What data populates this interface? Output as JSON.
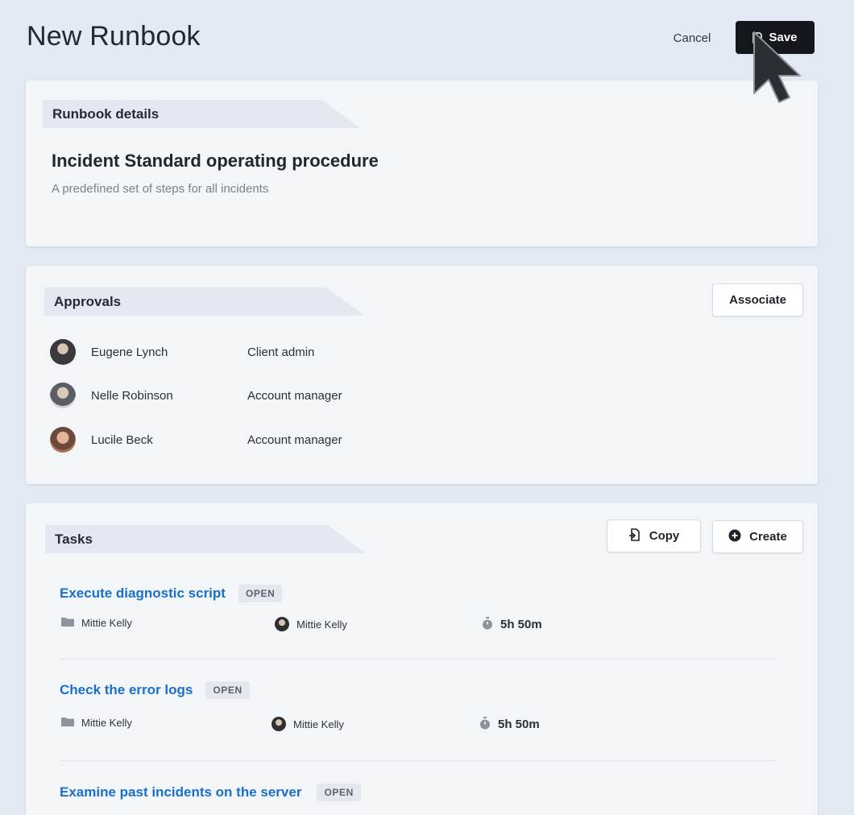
{
  "header": {
    "title": "New Runbook",
    "cancel_label": "Cancel",
    "save_label": "Save"
  },
  "details": {
    "section_label": "Runbook details",
    "name": "Incident Standard operating procedure",
    "description": "A predefined set of steps for all incidents"
  },
  "approvals": {
    "section_label": "Approvals",
    "associate_label": "Associate",
    "approvers": [
      {
        "name": "Eugene Lynch",
        "role": "Client admin"
      },
      {
        "name": "Nelle Robinson",
        "role": "Account manager"
      },
      {
        "name": "Lucile Beck",
        "role": "Account manager"
      }
    ]
  },
  "tasks": {
    "section_label": "Tasks",
    "copy_label": "Copy",
    "create_label": "Create",
    "items": [
      {
        "title": "Execute diagnostic script",
        "status": "OPEN",
        "folder": "Mittie Kelly",
        "assignee": "Mittie Kelly",
        "duration": "5h 50m"
      },
      {
        "title": "Check the error logs",
        "status": "OPEN",
        "folder": "Mittie Kelly",
        "assignee": "Mittie Kelly",
        "duration": "5h 50m"
      },
      {
        "title": "Examine past incidents on the server",
        "status": "OPEN"
      }
    ]
  },
  "icons": {
    "save": "save-icon",
    "copy": "copy-icon",
    "create": "plus-circle-icon",
    "folder": "folder-icon",
    "timer": "stopwatch-icon",
    "cursor": "cursor-icon"
  },
  "colors": {
    "background": "#e3eaf4",
    "card": "#f3f6f9",
    "primary_button": "#14171c",
    "link": "#1a6fc9",
    "badge": "#e4e8ee"
  }
}
